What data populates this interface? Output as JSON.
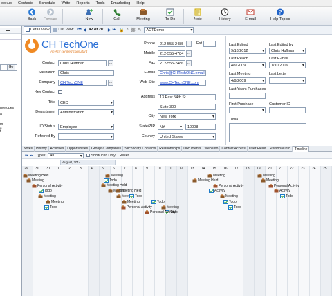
{
  "menu": [
    "ookup",
    "Contacts",
    "Schedule",
    "Write",
    "Reports",
    "Tools",
    "Emarketing",
    "Help"
  ],
  "toolbar": {
    "back": "Back",
    "forward": "Forward",
    "new": "New",
    "call": "Call",
    "meeting": "Meeting",
    "todo": "To-Do",
    "note": "Note",
    "history": "History",
    "email": "E-mail",
    "help": "Help Topics"
  },
  "nav": {
    "detail_view": "Detail View",
    "list_view": "List View",
    "record_counter": "42 of 201",
    "database": "ACTDemo"
  },
  "company_logo": {
    "name": "CH TechOne",
    "tagline": "An Act! certified consultant"
  },
  "contact": {
    "contact_label": "Contact",
    "contact": "Chris Huffman",
    "salutation_label": "Salutation",
    "salutation": "Chris",
    "company_label": "Company",
    "company": "CH TechONE",
    "key_contact_label": "Key Contact",
    "title_label": "Title",
    "title": "CEO",
    "department_label": "Department",
    "department": "Administration",
    "id_status_label": "ID/Status",
    "id_status": "Employee",
    "referred_by_label": "Referred By",
    "referred_by": "",
    "phone_label": "Phone",
    "phone": "212-555-2485",
    "ext_label": "Ext",
    "mobile_label": "Mobile",
    "mobile": "212-555-4784",
    "fax_label": "Fax",
    "fax": "212-555-2486",
    "email_label": "E-mail",
    "email": "Chris@CHTechONE.email",
    "website_label": "Web Site",
    "website": "www.CHTechONE.com",
    "address_label": "Address",
    "address1": "13 East 54th St.",
    "address2": "Suite 300",
    "city_label": "City",
    "city": "New York",
    "state_zip_label": "State/ZIP",
    "state": "NY",
    "zip": "10008",
    "country_label": "Country",
    "country": "United States"
  },
  "history": {
    "last_edited_label": "Last Edited",
    "last_edited": "9/18/2012",
    "last_edited_by_label": "Last Edited by",
    "last_edited_by": "Chris Huffman",
    "last_reach_label": "Last Reach",
    "last_reach": "4/9/2009",
    "last_email_label": "Last E-mail",
    "last_email": "1/10/2006",
    "last_meeting_label": "Last Meeting",
    "last_meeting": "4/9/2009",
    "last_letter_label": "Last Letter",
    "last_letter": "",
    "last_years_purchases_label": "Last Years Purchases",
    "first_purchase_label": "First Purchase",
    "customer_id_label": "Customer ID",
    "trivia_label": "Trivia"
  },
  "tabs": [
    "Notes",
    "History",
    "Activities",
    "Opportunities",
    "Groups/Companies",
    "Secondary Contacts",
    "Relationships",
    "Documents",
    "Web Info",
    "Contact Access",
    "User Fields",
    "Personal Info",
    "Timeline"
  ],
  "timeline": {
    "types_label": "Types:",
    "types_value": "All",
    "show_icon_only": "Show Icon Only",
    "reset": "Reset",
    "month": "August, 2014",
    "days": [
      "29",
      "30",
      "31",
      "1",
      "2",
      "3",
      "4",
      "5",
      "6",
      "7",
      "8",
      "9",
      "10",
      "11",
      "12",
      "13",
      "14",
      "15",
      "16",
      "17",
      "18",
      "19",
      "20",
      "21",
      "22",
      "23",
      "24",
      "25"
    ],
    "activities": [
      {
        "type": "meeting",
        "label": "Meeting Held"
      },
      {
        "type": "meeting",
        "label": "Meeting"
      },
      {
        "type": "personal",
        "label": "Personal Activity"
      },
      {
        "type": "todo",
        "label": "Todo"
      },
      {
        "type": "meeting",
        "label": "Meeting"
      },
      {
        "type": "meeting",
        "label": "Meeting"
      },
      {
        "type": "todo",
        "label": "Todo"
      },
      {
        "type": "meeting",
        "label": "Meeting"
      },
      {
        "type": "todo",
        "label": "Todo"
      },
      {
        "type": "meeting",
        "label": "Meeting Held"
      },
      {
        "type": "meeting",
        "label": "Meeting"
      },
      {
        "type": "meeting",
        "label": "Meeting Held"
      },
      {
        "type": "meeting",
        "label": "Meeting"
      },
      {
        "type": "todo",
        "label": "Todo"
      },
      {
        "type": "meeting",
        "label": "Meeting"
      },
      {
        "type": "personal",
        "label": "Personal Activity"
      },
      {
        "type": "todo",
        "label": "Todo"
      },
      {
        "type": "meeting",
        "label": "Meeting"
      },
      {
        "type": "todo",
        "label": "Todo"
      },
      {
        "type": "personal",
        "label": "Personal Activity"
      },
      {
        "type": "meeting",
        "label": "Meeting"
      },
      {
        "type": "meeting",
        "label": "Meeting Held"
      },
      {
        "type": "personal",
        "label": "Personal Activity"
      },
      {
        "type": "todo",
        "label": "Activity"
      },
      {
        "type": "meeting",
        "label": "Meeting"
      },
      {
        "type": "todo",
        "label": "Todo"
      },
      {
        "type": "todo",
        "label": "Todo"
      },
      {
        "type": "meeting",
        "label": "Meeting"
      },
      {
        "type": "meeting",
        "label": "Meeting"
      },
      {
        "type": "personal",
        "label": "Personal Activity"
      },
      {
        "type": "personal",
        "label": "Activity"
      },
      {
        "type": "todo",
        "label": "Todo"
      }
    ]
  },
  "left_panel": {
    "go": "Go",
    "velopes": "nvelopes",
    "a": "a",
    "m": "m",
    "s": "s",
    "t": "t"
  }
}
